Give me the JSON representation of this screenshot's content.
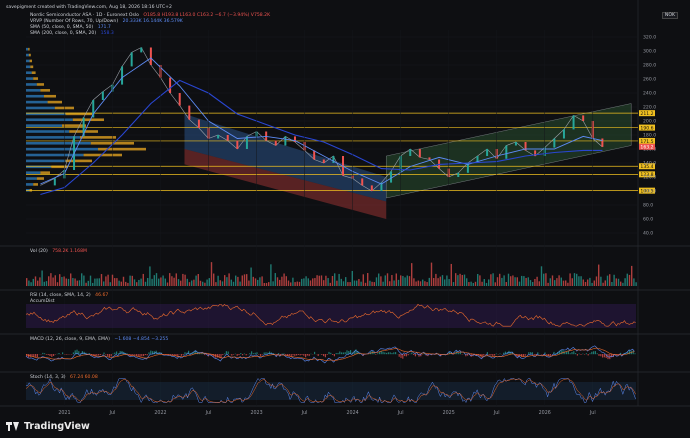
{
  "header": {
    "created": "savepigment created with TradingView.com, Aug 18, 2026 18:16 UTC+2",
    "symbol": "Nordic Semiconductor ASA · 1D · Euronext Oslo",
    "ohlc": "O185.8 H193.8 L163.0 C163.2 −6.7 (−3.94%) V758.2K",
    "vrvp": "VRVP (Number Of Rows, 70, Up/Down)",
    "vrvp_vals": "20.333K 16.144K 36.579K",
    "sma50": "SMA (50, close, 0, SMA, 50)",
    "sma50_val": "171.7",
    "sma200": "SMA (200, close, 0, SMA, 20)",
    "sma200_val": "158.3",
    "currency": "NOK"
  },
  "panes": {
    "vol_label": "Vol (20)",
    "vol_vals": "758.2K 1.168M",
    "rsi_label": "RSI (14, close, SMA, 14, 2)",
    "rsi_vals": "46.67",
    "accum_label": "AccumDist",
    "macd_label": "MACD (12, 26, close, 9, EMA, EMA)",
    "macd_vals": "−1.608 −4.854 −3.255",
    "stoch_label": "Stoch (14, 3, 3)",
    "stoch_vals": "67.24 60.08"
  },
  "brand": "TradingView",
  "colors": {
    "up": "#26a69a",
    "down": "#ef5350",
    "sma50": "#5d8bf4",
    "sma200": "#2946d1",
    "hline": "#f0c020",
    "vrvp_up": "#2e7fc2",
    "vrvp_down": "#e0a020",
    "channel_up": "#3a78c8",
    "channel_down": "#b33a3a",
    "channel_green": "#2f5a36",
    "rsi": "#ef6c2c",
    "macd": "#5d8bf4",
    "signal": "#ef6c2c",
    "stoch_k": "#5d8bf4",
    "stoch_d": "#ef6c2c"
  },
  "chart_data": {
    "type": "line",
    "title": "Nordic Semiconductor ASA · 1D · Euronext Oslo",
    "x_ticks": [
      "2021",
      "Jul",
      "2022",
      "Jul",
      "2023",
      "Jul",
      "2024",
      "Jul",
      "2025",
      "Jul",
      "2026",
      "Jul"
    ],
    "price_ticks": [
      320.0,
      300.0,
      280.0,
      260.0,
      240.0,
      220.0,
      200.0,
      180.0,
      160.0,
      140.0,
      120.0,
      100.0,
      80.0,
      60.0,
      40.0
    ],
    "ylim": [
      30,
      330
    ],
    "horizontal_levels": [
      211.2,
      190.6,
      171.5,
      135.4,
      123.8,
      100.5
    ],
    "last_price": 163.2,
    "series": [
      {
        "name": "Price",
        "x": [
          2020.75,
          2020.9,
          2021.0,
          2021.1,
          2021.2,
          2021.3,
          2021.4,
          2021.5,
          2021.6,
          2021.7,
          2021.8,
          2021.9,
          2022.0,
          2022.1,
          2022.2,
          2022.3,
          2022.4,
          2022.5,
          2022.6,
          2022.7,
          2022.8,
          2022.9,
          2023.0,
          2023.1,
          2023.2,
          2023.3,
          2023.4,
          2023.5,
          2023.6,
          2023.7,
          2023.8,
          2023.9,
          2024.0,
          2024.1,
          2024.2,
          2024.3,
          2024.4,
          2024.5,
          2024.6,
          2024.7,
          2024.8,
          2024.9,
          2025.0,
          2025.1,
          2025.2,
          2025.3,
          2025.4,
          2025.5,
          2025.6,
          2025.7,
          2025.8,
          2025.9,
          2026.0,
          2026.1,
          2026.2,
          2026.3,
          2026.4,
          2026.5,
          2026.6
        ],
        "y": [
          108,
          118,
          130,
          178,
          205,
          230,
          242,
          252,
          278,
          298,
          305,
          280,
          262,
          240,
          222,
          202,
          190,
          175,
          180,
          172,
          160,
          178,
          185,
          172,
          165,
          178,
          170,
          158,
          145,
          140,
          150,
          122,
          118,
          108,
          100,
          112,
          128,
          150,
          160,
          148,
          145,
          132,
          120,
          126,
          140,
          150,
          160,
          146,
          165,
          170,
          158,
          150,
          162,
          175,
          188,
          208,
          200,
          175,
          163
        ]
      },
      {
        "name": "SMA 50",
        "x": [
          2020.75,
          2021.0,
          2021.3,
          2021.6,
          2021.9,
          2022.2,
          2022.5,
          2022.8,
          2023.1,
          2023.4,
          2023.7,
          2024.0,
          2024.3,
          2024.6,
          2024.9,
          2025.2,
          2025.5,
          2025.8,
          2026.1,
          2026.4,
          2026.6
        ],
        "y": [
          110,
          125,
          210,
          262,
          290,
          250,
          200,
          175,
          178,
          172,
          150,
          128,
          110,
          135,
          148,
          138,
          150,
          160,
          160,
          178,
          172
        ]
      },
      {
        "name": "SMA 200",
        "x": [
          2020.75,
          2021.0,
          2021.3,
          2021.6,
          2021.9,
          2022.2,
          2022.5,
          2022.8,
          2023.1,
          2023.4,
          2023.7,
          2024.0,
          2024.3,
          2024.6,
          2024.9,
          2025.2,
          2025.5,
          2025.8,
          2026.1,
          2026.4,
          2026.6
        ],
        "y": [
          95,
          105,
          140,
          180,
          225,
          258,
          240,
          210,
          195,
          180,
          170,
          152,
          132,
          130,
          138,
          140,
          142,
          150,
          155,
          158,
          158
        ]
      }
    ]
  }
}
